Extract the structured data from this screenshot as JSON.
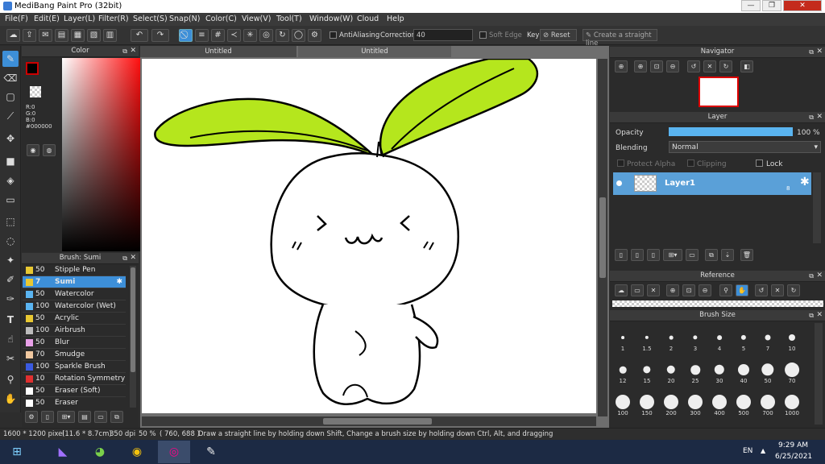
{
  "window": {
    "title": "MediBang Paint Pro (32bit)",
    "minimize": "—",
    "restore": "❐",
    "close": "✕"
  },
  "menu": [
    "File(F)",
    "Edit(E)",
    "Layer(L)",
    "Filter(R)",
    "Select(S)",
    "Snap(N)",
    "Color(C)",
    "View(V)",
    "Tool(T)",
    "Window(W)",
    "Cloud",
    "Help"
  ],
  "toolbar": {
    "antialiasing": "AntiAliasing",
    "correction_label": "Correction",
    "correction_value": "40",
    "soft_edge": "Soft Edge",
    "key": "Key",
    "reset": "Reset",
    "straight_line": "Create a straight line"
  },
  "color_panel": {
    "title": "Color",
    "r": "R:0",
    "g": "G:0",
    "b": "B:0",
    "hex": "#000000"
  },
  "brush_panel": {
    "title": "Brush: Sumi",
    "items": [
      {
        "size": "50",
        "name": "Stipple Pen",
        "color": "#e8c832"
      },
      {
        "size": "7",
        "name": "Sumi",
        "color": "#e8c832",
        "selected": true
      },
      {
        "size": "50",
        "name": "Watercolor",
        "color": "#5ab4f0"
      },
      {
        "size": "100",
        "name": "Watercolor (Wet)",
        "color": "#5ab4f0"
      },
      {
        "size": "50",
        "name": "Acrylic",
        "color": "#e8c832"
      },
      {
        "size": "100",
        "name": "Airbrush",
        "color": "#bbbbbb"
      },
      {
        "size": "50",
        "name": "Blur",
        "color": "#e8a0e8"
      },
      {
        "size": "70",
        "name": "Smudge",
        "color": "#f0c8a0"
      },
      {
        "size": "100",
        "name": "Sparkle Brush",
        "color": "#3a5ae0"
      },
      {
        "size": "10",
        "name": "Rotation Symmetry P",
        "color": "#e03030"
      },
      {
        "size": "50",
        "name": "Eraser (Soft)",
        "color": "#ffffff"
      },
      {
        "size": "50",
        "name": "Eraser",
        "color": "#ffffff"
      }
    ]
  },
  "tabs": [
    "Untitled",
    "Untitled"
  ],
  "navigator": {
    "title": "Navigator"
  },
  "layer_panel": {
    "title": "Layer",
    "opacity_label": "Opacity",
    "opacity_value": "100 %",
    "opacity_fraction": 1.0,
    "blending_label": "Blending",
    "blending_value": "Normal",
    "protect_alpha": "Protect Alpha",
    "clipping": "Clipping",
    "lock": "Lock",
    "layer_name": "Layer1",
    "layer_num": "8"
  },
  "reference": {
    "title": "Reference"
  },
  "brush_size": {
    "title": "Brush Size",
    "sizes": [
      "1",
      "1.5",
      "2",
      "3",
      "4",
      "5",
      "7",
      "10",
      "12",
      "15",
      "20",
      "25",
      "30",
      "40",
      "50",
      "70",
      "100",
      "150",
      "200",
      "300",
      "400",
      "500",
      "700",
      "1000"
    ]
  },
  "status": {
    "dims": "1600 * 1200 pixel",
    "cm": "(11.6 * 8.7cm)",
    "dpi": "350 dpi",
    "zoom": "50 %",
    "coords": "( 760, 688 )",
    "hint": "Draw a straight line by holding down Shift, Change a brush size by holding down Ctrl, Alt, and dragging"
  },
  "taskbar": {
    "lang": "EN",
    "time": "9:29 AM",
    "date": "6/25/2021"
  },
  "colors": {
    "accent": "#3d8fd8",
    "leaf": "#b5e61d"
  }
}
